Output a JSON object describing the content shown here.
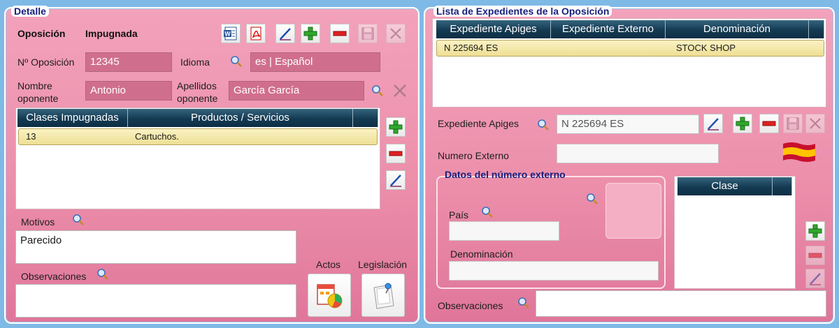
{
  "detalle": {
    "title": "Detalle",
    "oposicion_label": "Oposición",
    "impugnada_label": "Impugnada",
    "num_oposicion_label": "Nº Oposición",
    "num_oposicion_value": "12345",
    "idioma_label": "Idioma",
    "idioma_value": "es | Español",
    "nombre_label_1": "Nombre",
    "nombre_label_2": "oponente",
    "nombre_value": "Antonio",
    "apellidos_label_1": "Apellidos",
    "apellidos_label_2": "oponente",
    "apellidos_value": "García García",
    "grid": {
      "headers": [
        "Clases Impugnadas",
        "Productos / Servicios"
      ],
      "rows": [
        {
          "clase": "13",
          "productos": "Cartuchos."
        }
      ]
    },
    "motivos_label": "Motivos",
    "motivos_value": "Parecido",
    "observaciones_label": "Observaciones",
    "observaciones_value": "",
    "actos_label": "Actos",
    "legislacion_label": "Legislación"
  },
  "lista": {
    "title": "Lista de Expedientes de la Oposición",
    "headers": [
      "Expediente Apiges",
      "Expediente Externo",
      "Denominación"
    ],
    "rows": [
      {
        "apiges": "N 225694 ES",
        "externo": "",
        "denominacion": "STOCK SHOP"
      }
    ],
    "expediente_apiges_label": "Expediente Apiges",
    "expediente_apiges_value": "N 225694 ES",
    "numero_externo_label": "Numero Externo",
    "numero_externo_value": "",
    "datos_title": "Datos del número externo",
    "pais_label": "País",
    "pais_value": "",
    "denominacion_label": "Denominación",
    "denominacion_value": "",
    "clase_header": "Clase",
    "observaciones_label": "Observaciones",
    "observaciones_value": "",
    "flag_colors": {
      "red": "#c8102e",
      "yellow": "#ffc400"
    }
  },
  "colors": {
    "panel": "#ec8fab",
    "grid_header": "#143a52",
    "selected_row": "#eedf94",
    "title": "#17207c"
  }
}
